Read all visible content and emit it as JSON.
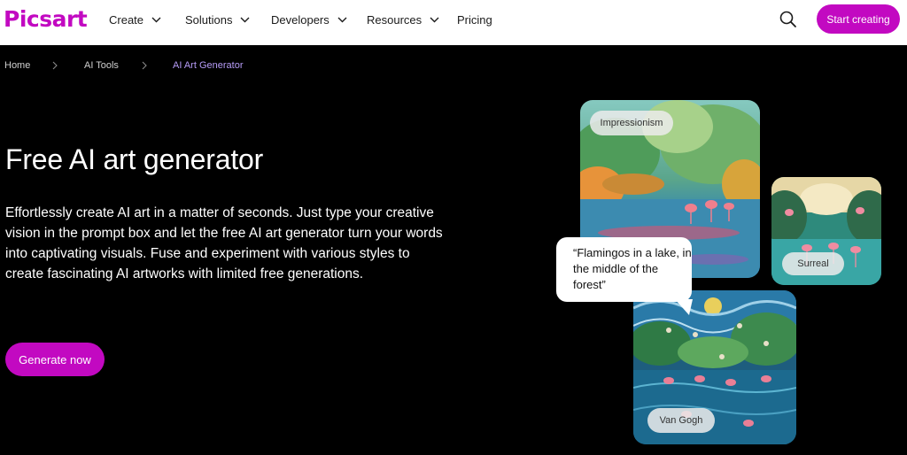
{
  "brand": {
    "logo_text": "Picsart",
    "accent": "#c209c1",
    "link_active": "#b69cf7"
  },
  "nav": {
    "items": [
      {
        "label": "Create",
        "has_dropdown": true
      },
      {
        "label": "Solutions",
        "has_dropdown": true
      },
      {
        "label": "Developers",
        "has_dropdown": true
      },
      {
        "label": "Resources",
        "has_dropdown": true
      },
      {
        "label": "Pricing",
        "has_dropdown": false
      }
    ],
    "search_icon": "search-icon",
    "cta_label": "Start creating"
  },
  "breadcrumb": {
    "items": [
      {
        "label": "Home"
      },
      {
        "label": "AI Tools"
      },
      {
        "label": "AI Art Generator"
      }
    ],
    "separator_icon": "chevron-right-icon"
  },
  "hero": {
    "title": "Free AI art generator",
    "description": "Effortlessly create AI art in a matter of seconds. Just type your creative vision in the prompt box and let the free AI art generator turn your words into captivating visuals. Fuse and experiment with various styles to create fascinating AI artworks with limited free generations.",
    "cta_label": "Generate now"
  },
  "showcase": {
    "styles": [
      {
        "label": "Impressionism"
      },
      {
        "label": "Surreal"
      },
      {
        "label": "Van Gogh"
      }
    ],
    "prompt_quote": "“Flamingos in a lake, in the middle of the forest”"
  }
}
